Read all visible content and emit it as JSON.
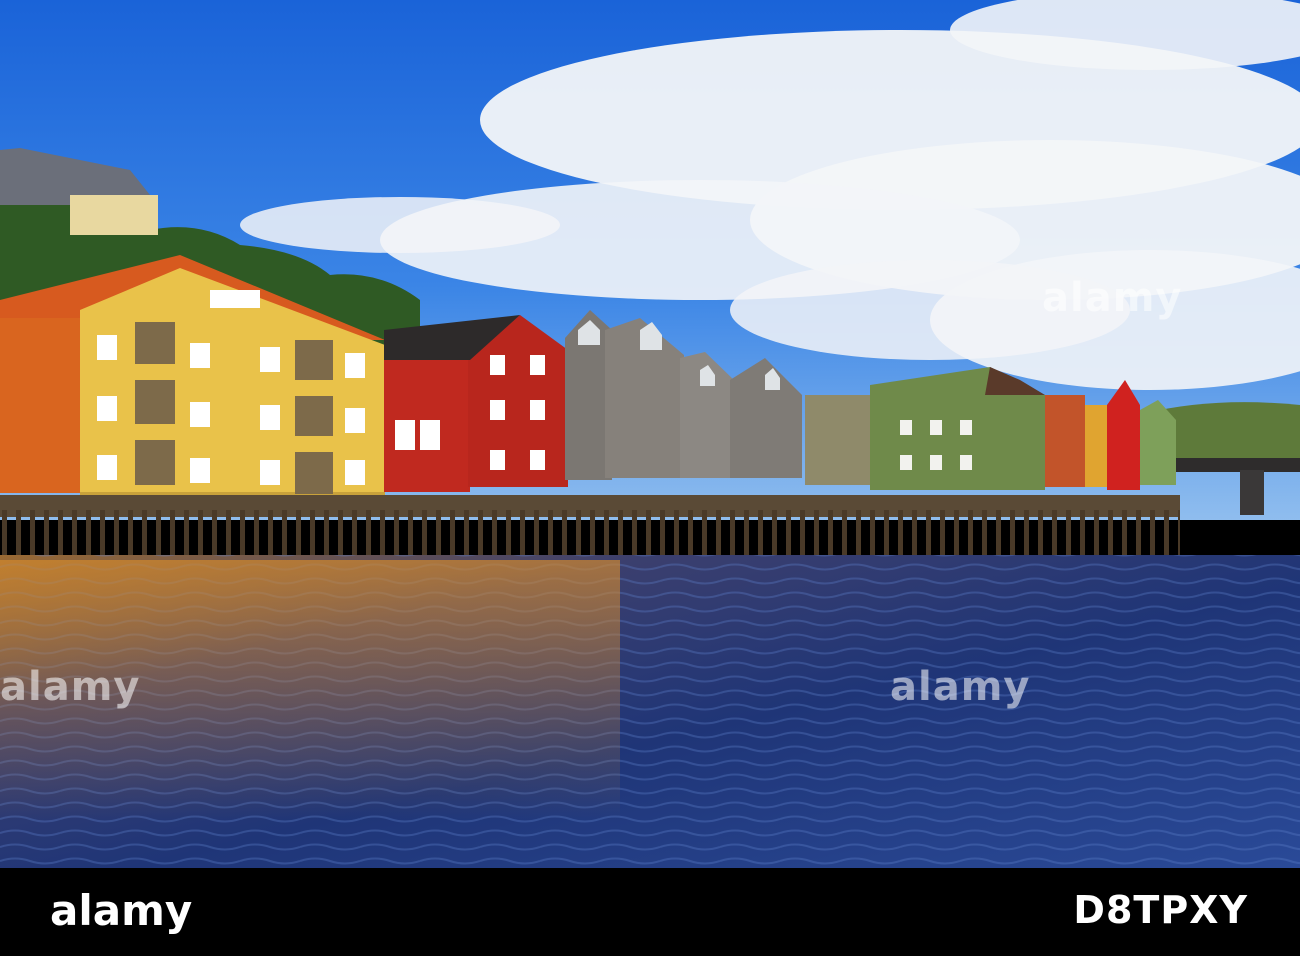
{
  "image": {
    "subject": "colorful wooden wharf houses on stilts along a river",
    "colors": {
      "sky_top": "#1d6fe0",
      "sky_low": "#7fb4ee",
      "cloud": "#f4f6f9",
      "water_deep": "#152a66",
      "water_mid": "#2b4791",
      "yellow_house": "#e9c24a",
      "orange_house": "#d9651f",
      "red_house": "#c0291f",
      "grey_house": "#7b7772",
      "green_house": "#6f8a4a"
    }
  },
  "watermarks": {
    "primary": "alamy",
    "mid_right": "alamy",
    "mid_left": "alamy"
  },
  "footer": {
    "brand": "alamy",
    "image_id": "D8TPXY"
  }
}
